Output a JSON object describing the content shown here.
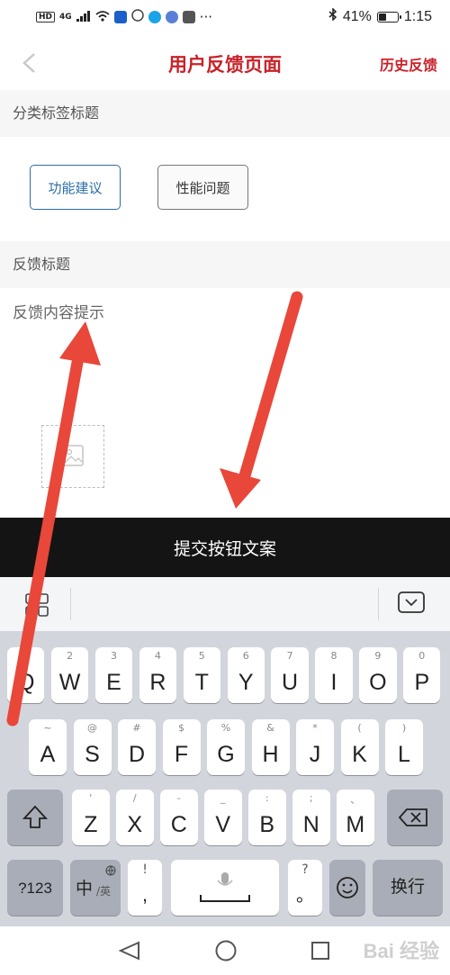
{
  "status_bar": {
    "hd": "HD",
    "network": "4G",
    "dots": "···",
    "battery_pct": "41%",
    "battery_level": 0.41,
    "time": "1:15"
  },
  "header": {
    "title": "用户反馈页面",
    "history": "历史反馈"
  },
  "category": {
    "heading": "分类标签标题",
    "tags": [
      {
        "label": "功能建议",
        "selected": true
      },
      {
        "label": "性能问题",
        "selected": false
      }
    ]
  },
  "feedback": {
    "heading": "反馈标题",
    "content_placeholder": "反馈内容提示"
  },
  "submit_label": "提交按钮文案",
  "keyboard": {
    "row1": [
      {
        "sub": "1",
        "main": "Q"
      },
      {
        "sub": "2",
        "main": "W"
      },
      {
        "sub": "3",
        "main": "E"
      },
      {
        "sub": "4",
        "main": "R"
      },
      {
        "sub": "5",
        "main": "T"
      },
      {
        "sub": "6",
        "main": "Y"
      },
      {
        "sub": "7",
        "main": "U"
      },
      {
        "sub": "8",
        "main": "I"
      },
      {
        "sub": "9",
        "main": "O"
      },
      {
        "sub": "0",
        "main": "P"
      }
    ],
    "row2": [
      {
        "sub": "~",
        "main": "A"
      },
      {
        "sub": "@",
        "main": "S"
      },
      {
        "sub": "#",
        "main": "D"
      },
      {
        "sub": "$",
        "main": "F"
      },
      {
        "sub": "%",
        "main": "G"
      },
      {
        "sub": "&",
        "main": "H"
      },
      {
        "sub": "*",
        "main": "J"
      },
      {
        "sub": "(",
        "main": "K"
      },
      {
        "sub": ")",
        "main": "L"
      }
    ],
    "row3": [
      {
        "sub": "'",
        "main": "Z"
      },
      {
        "sub": "/",
        "main": "X"
      },
      {
        "sub": "-",
        "main": "C"
      },
      {
        "sub": "_",
        "main": "V"
      },
      {
        "sub": ":",
        "main": "B"
      },
      {
        "sub": ";",
        "main": "N"
      },
      {
        "sub": "、",
        "main": "M"
      }
    ],
    "numbers_key": "?123",
    "lang_key_main": "中",
    "lang_key_alt": "/英",
    "excl_sub": "!",
    "excl_main": ",",
    "question_sub": "?",
    "question_main": "。",
    "enter_key": "换行"
  },
  "watermark": "Bai 经验",
  "colors": {
    "accent_red": "#c8222a",
    "tag_blue": "#2c6da6",
    "arrow_red": "#e8473a",
    "submit_bg": "#141414"
  }
}
